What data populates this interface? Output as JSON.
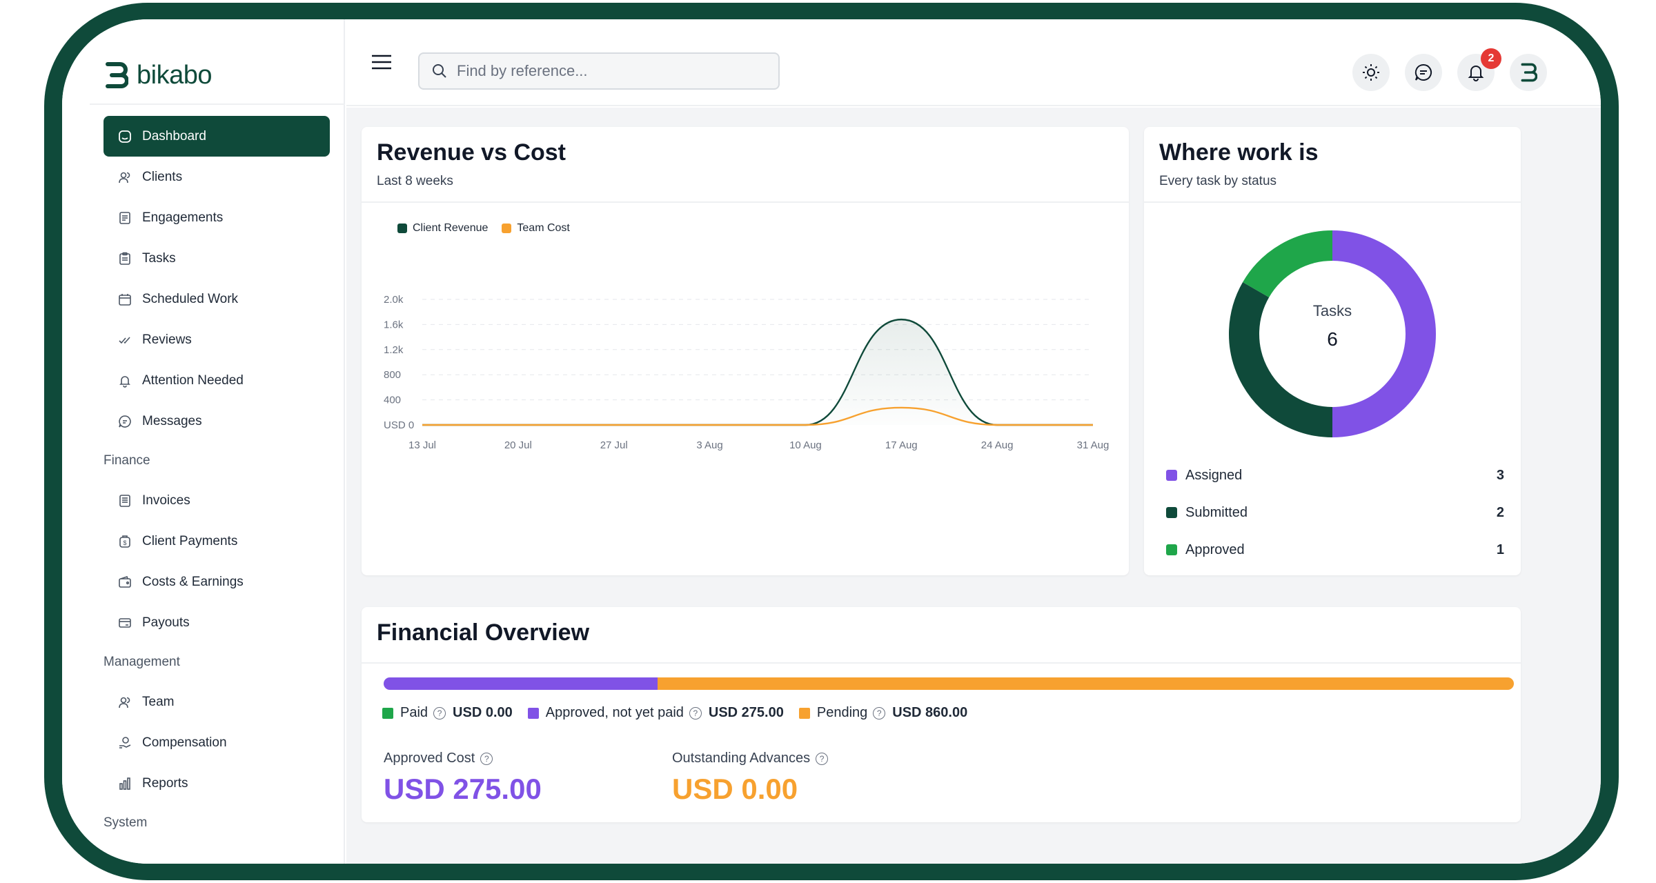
{
  "brand": {
    "name": "bikabo",
    "color": "#0f4a3a"
  },
  "sidebar": {
    "items": [
      {
        "label": "Dashboard",
        "icon": "dashboard-icon",
        "active": true
      },
      {
        "label": "Clients",
        "icon": "users-icon"
      },
      {
        "label": "Engagements",
        "icon": "document-icon"
      },
      {
        "label": "Tasks",
        "icon": "clipboard-icon"
      },
      {
        "label": "Scheduled Work",
        "icon": "calendar-icon"
      },
      {
        "label": "Reviews",
        "icon": "double-check-icon"
      },
      {
        "label": "Attention Needed",
        "icon": "bell-icon"
      },
      {
        "label": "Messages",
        "icon": "chat-icon"
      }
    ],
    "finance_label": "Finance",
    "finance": [
      {
        "label": "Invoices",
        "icon": "invoice-icon"
      },
      {
        "label": "Client Payments",
        "icon": "payment-icon"
      },
      {
        "label": "Costs & Earnings",
        "icon": "wallet-icon"
      },
      {
        "label": "Payouts",
        "icon": "card-icon"
      }
    ],
    "management_label": "Management",
    "management": [
      {
        "label": "Team",
        "icon": "team-icon"
      },
      {
        "label": "Compensation",
        "icon": "hand-coin-icon"
      },
      {
        "label": "Reports",
        "icon": "bar-chart-icon"
      }
    ],
    "system_label": "System"
  },
  "topbar": {
    "search_placeholder": "Find by reference...",
    "notifications_count": "2"
  },
  "revenue_card": {
    "title": "Revenue vs Cost",
    "subtitle": "Last 8 weeks"
  },
  "work_card": {
    "title": "Where work is",
    "subtitle": "Every task by status",
    "center_label": "Tasks",
    "center_value": "6"
  },
  "financial_card": {
    "title": "Financial Overview",
    "paid_label": "Paid",
    "paid_value": "USD 0.00",
    "approved_label": "Approved, not yet paid",
    "approved_value": "USD 275.00",
    "pending_label": "Pending",
    "pending_value": "USD 860.00",
    "approved_fraction": 0.2423,
    "pending_fraction": 0.7577,
    "approved_cost_label": "Approved Cost",
    "approved_cost_value": "USD 275.00",
    "outstanding_label": "Outstanding Advances",
    "outstanding_value": "USD 0.00"
  },
  "colors": {
    "accent": "#0f4a3a",
    "purple": "#8052e6",
    "orange": "#f7a12f",
    "green": "#1fa64a"
  },
  "chart_data": [
    {
      "type": "area",
      "title": "",
      "categories": [
        "13 Jul",
        "20 Jul",
        "27 Jul",
        "3 Aug",
        "10 Aug",
        "17 Aug",
        "24 Aug",
        "31 Aug"
      ],
      "series": [
        {
          "name": "Client Revenue",
          "color": "#0f4a3a",
          "values": [
            0,
            0,
            0,
            0,
            0,
            1680,
            0,
            0
          ]
        },
        {
          "name": "Team Cost",
          "color": "#f7a12f",
          "values": [
            0,
            0,
            0,
            0,
            0,
            275,
            0,
            0
          ]
        }
      ],
      "yticks": [
        "USD 0",
        "400",
        "800",
        "1.2k",
        "1.6k",
        "2.0k"
      ],
      "ylim": [
        0,
        2000
      ],
      "grid": true,
      "legend": "top-left"
    },
    {
      "type": "pie",
      "title": "",
      "categories": [
        "Assigned",
        "Submitted",
        "Approved"
      ],
      "values": [
        3,
        2,
        1
      ],
      "colors": [
        "#8052e6",
        "#0f4a3a",
        "#1fa64a"
      ],
      "legend": "bottom"
    }
  ]
}
